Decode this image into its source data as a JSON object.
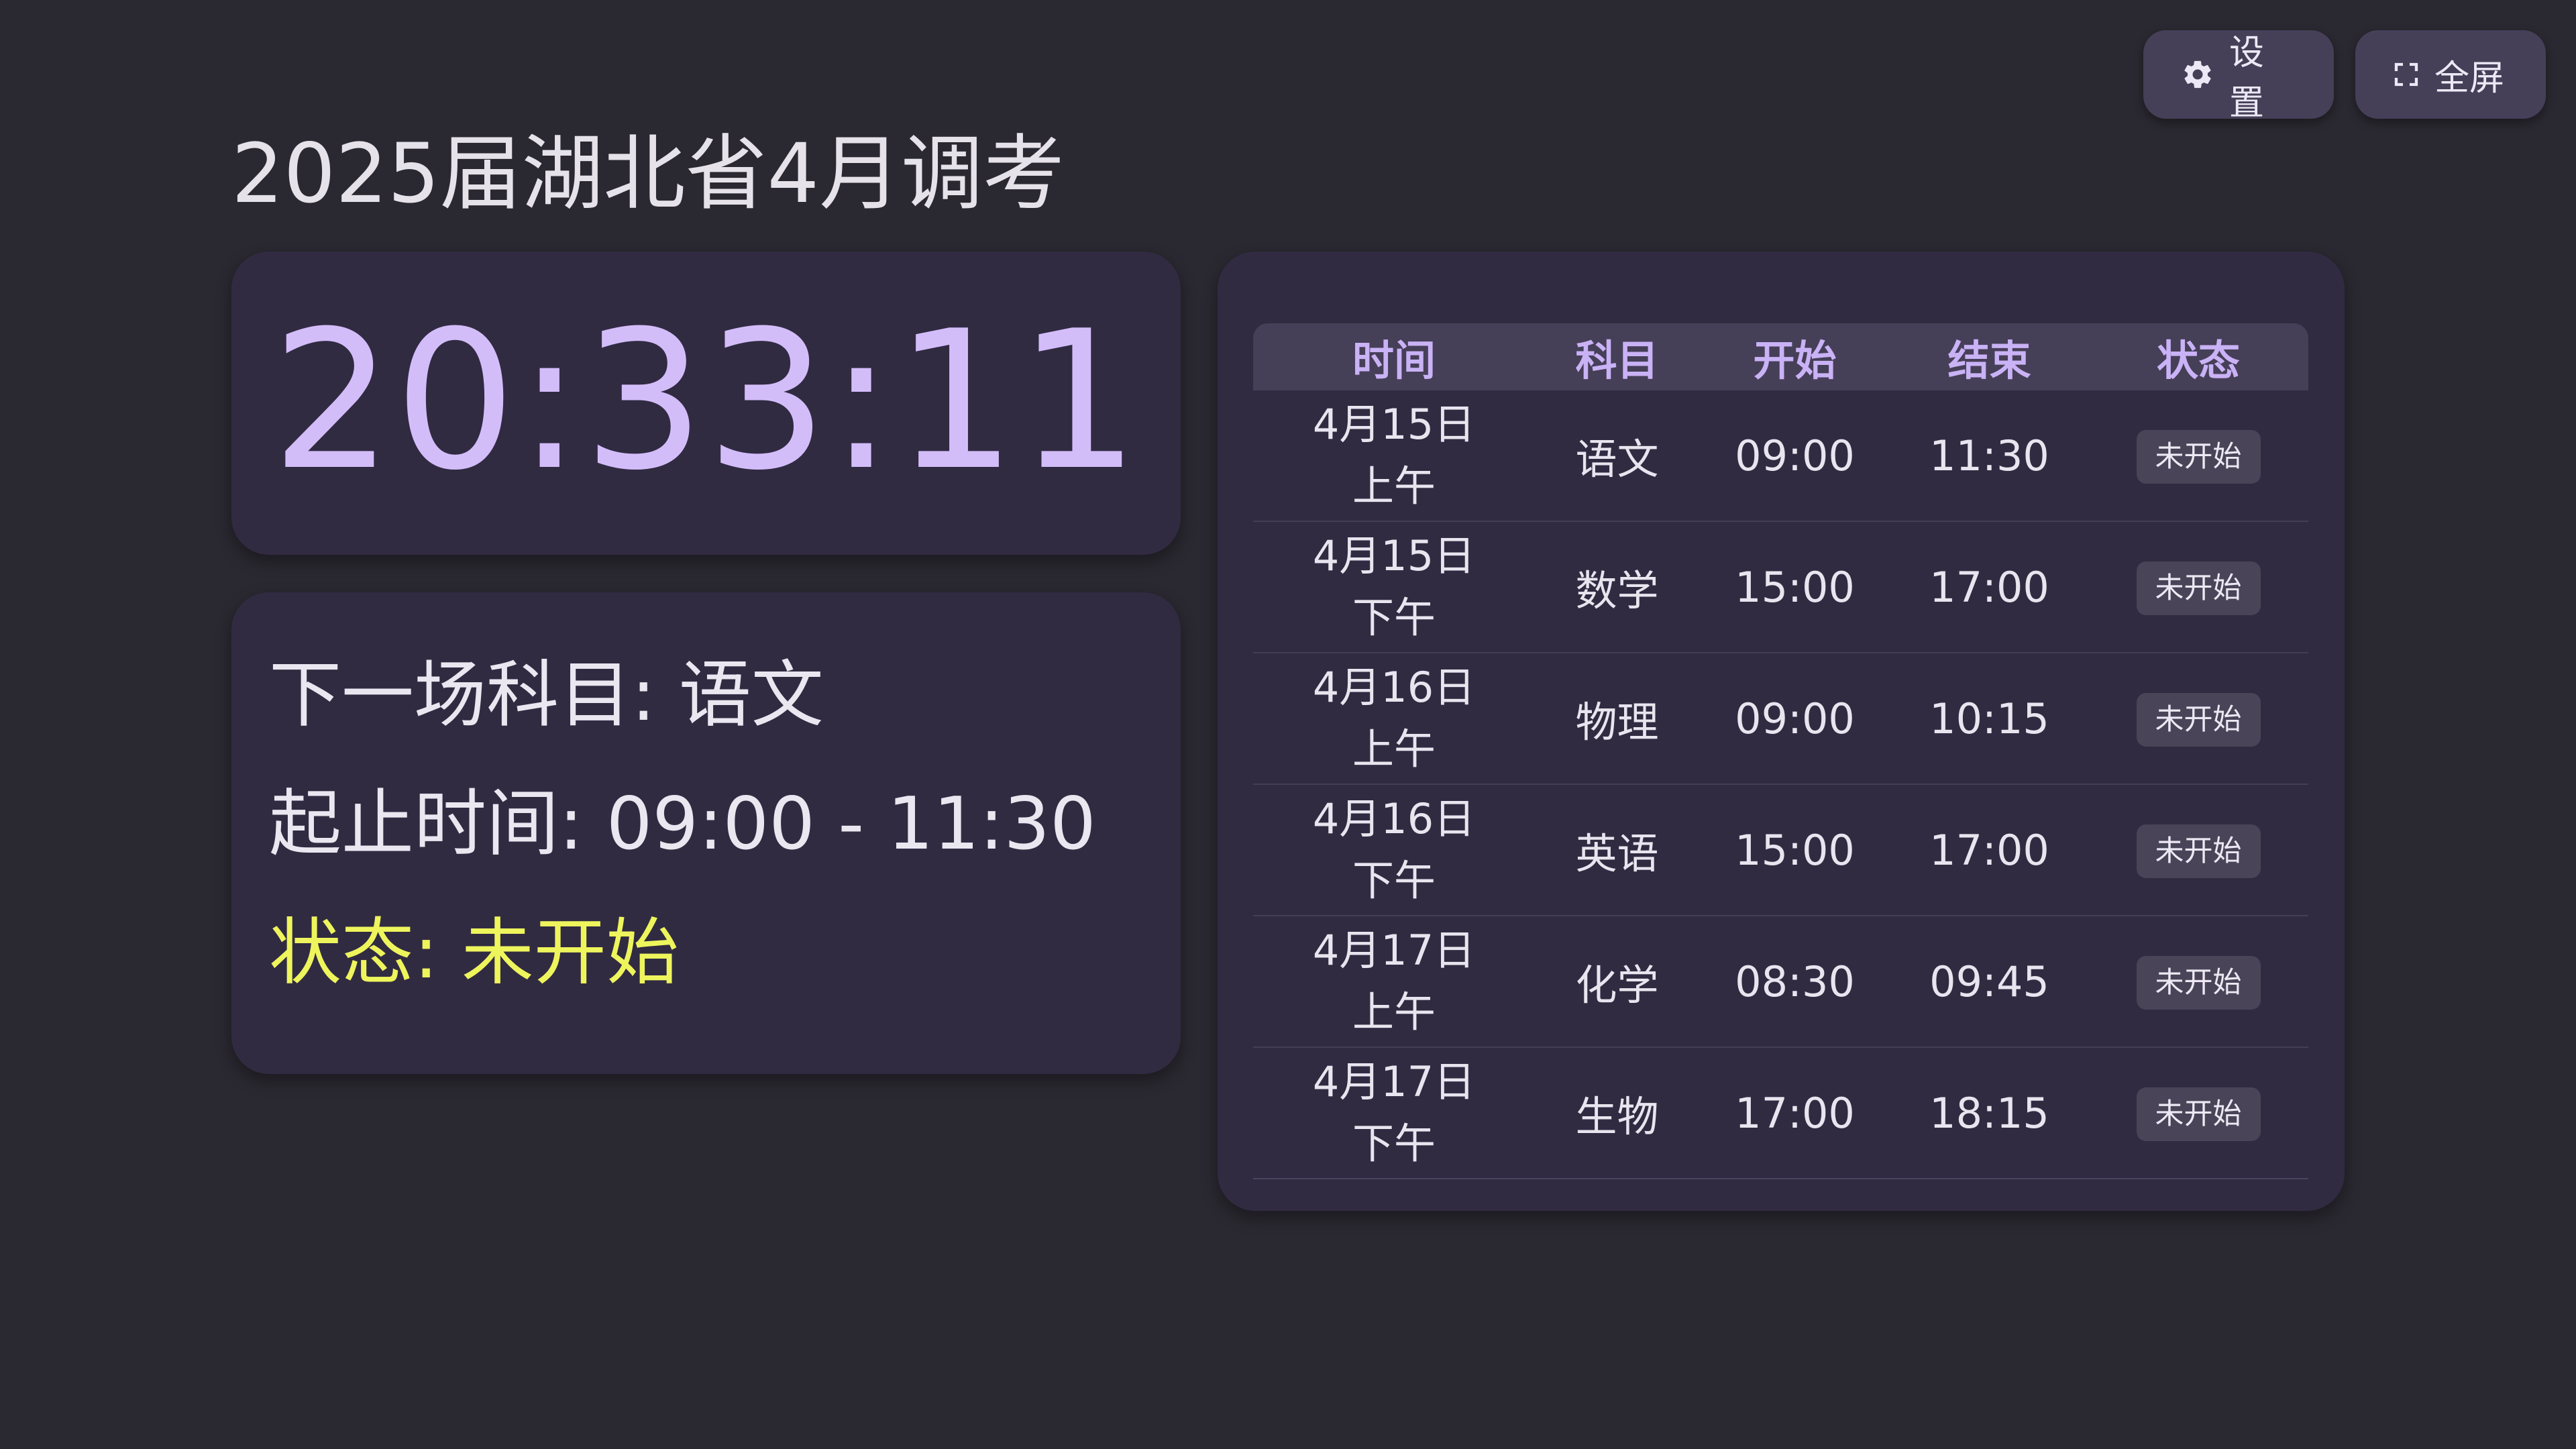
{
  "header": {
    "title": "2025届湖北省4月调考",
    "settings_label": "设置",
    "fullscreen_label": "全屏"
  },
  "clock": {
    "time": "20:33:11"
  },
  "info": {
    "next_subject": "下一场科目: 语文",
    "time_range": "起止时间: 09:00 - 11:30",
    "status": "状态: 未开始"
  },
  "schedule": {
    "columns": [
      "时间",
      "科目",
      "开始",
      "结束",
      "状态"
    ],
    "rows": [
      {
        "date": "4月15日",
        "period": "上午",
        "subject": "语文",
        "start": "09:00",
        "end": "11:30",
        "state": "未开始"
      },
      {
        "date": "4月15日",
        "period": "下午",
        "subject": "数学",
        "start": "15:00",
        "end": "17:00",
        "state": "未开始"
      },
      {
        "date": "4月16日",
        "period": "上午",
        "subject": "物理",
        "start": "09:00",
        "end": "10:15",
        "state": "未开始"
      },
      {
        "date": "4月16日",
        "period": "下午",
        "subject": "英语",
        "start": "15:00",
        "end": "17:00",
        "state": "未开始"
      },
      {
        "date": "4月17日",
        "period": "上午",
        "subject": "化学",
        "start": "08:30",
        "end": "09:45",
        "state": "未开始"
      },
      {
        "date": "4月17日",
        "period": "下午",
        "subject": "生物",
        "start": "17:00",
        "end": "18:15",
        "state": "未开始"
      }
    ]
  },
  "colors": {
    "background": "#2a2830",
    "card": "#312b42",
    "accent": "#d3bdf9",
    "status_text": "#eef55c"
  },
  "icons": {
    "settings": "gear-icon",
    "fullscreen": "fullscreen-icon"
  }
}
